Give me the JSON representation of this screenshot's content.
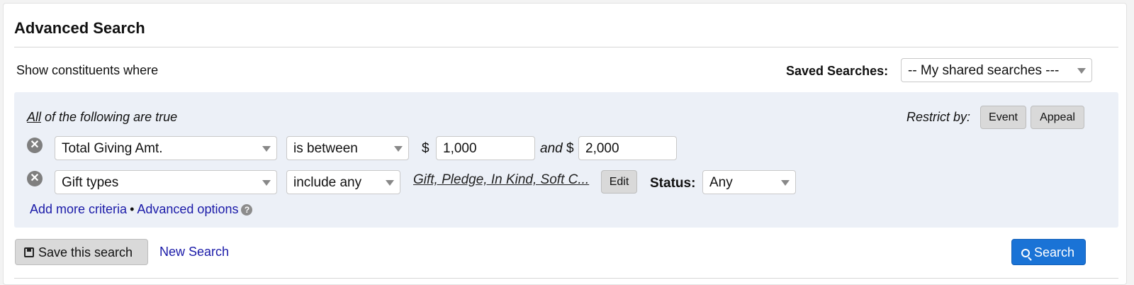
{
  "page": {
    "title": "Advanced Search",
    "subtitle": "Show constituents where"
  },
  "saved_searches": {
    "label": "Saved Searches:",
    "selected": "-- My shared searches ---"
  },
  "criteria": {
    "all_word": "All",
    "rest_label": " of the following are true",
    "restrict_label": "Restrict by:",
    "restrict_buttons": [
      "Event",
      "Appeal"
    ],
    "rows": [
      {
        "remove_icon": "close-icon",
        "field": "Total Giving Amt.",
        "operator": "is between",
        "currency": "$",
        "min": "1,000",
        "and_label": "and",
        "max": "2,000"
      },
      {
        "remove_icon": "close-icon",
        "field": "Gift types",
        "operator": "include any",
        "values_link": "Gift, Pledge, In Kind, Soft C...",
        "edit_label": "Edit",
        "status_label": "Status:",
        "status": "Any"
      }
    ],
    "add_more": "Add more criteria",
    "separator": "•",
    "advanced_options": "Advanced options",
    "help_icon": "question-circle-icon"
  },
  "footer": {
    "save_label": "Save this search",
    "save_icon": "floppy-disk-icon",
    "new_search": "New Search",
    "search_label": "Search",
    "search_icon": "search-icon"
  },
  "colors": {
    "link": "#1a1aa8",
    "primary": "#1a73d6",
    "criteria_bg": "#ecf0f7"
  }
}
